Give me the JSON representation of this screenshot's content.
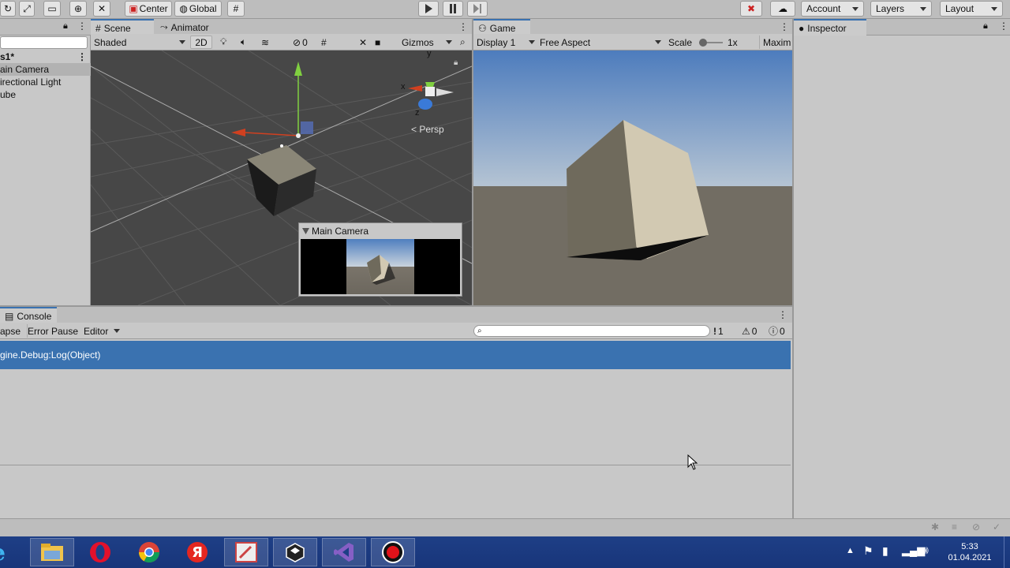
{
  "toolbar": {
    "center_label": "Center",
    "global_label": "Global",
    "account_label": "Account",
    "layers_label": "Layers",
    "layout_label": "Layout"
  },
  "hierarchy": {
    "scene_name": "s1*",
    "items": [
      "ain Camera",
      "irectional Light",
      "ube"
    ]
  },
  "scene_view": {
    "tabs": [
      "Scene",
      "Animator"
    ],
    "shading_mode": "Shaded",
    "mode_2d": "2D",
    "hidden_count": "0",
    "gizmos_label": "Gizmos",
    "axis_labels": {
      "x": "x",
      "y": "y",
      "z": "z"
    },
    "projection_label": "Persp",
    "camera_preview_title": "Main Camera"
  },
  "game_view": {
    "tab": "Game",
    "display": "Display 1",
    "aspect": "Free Aspect",
    "scale_label": "Scale",
    "scale_value": "1x",
    "maximize_label": "Maxim"
  },
  "inspector": {
    "tab": "Inspector"
  },
  "console": {
    "tab": "Console",
    "collapse_label": "apse",
    "error_pause_label": "Error Pause",
    "editor_label": "Editor",
    "log_count": "1",
    "warn_count": "0",
    "error_count": "0",
    "entries": [
      "gine.Debug:Log(Object)"
    ]
  },
  "taskbar": {
    "time": "5:33",
    "date": "01.04.2021"
  },
  "colors": {
    "selection_blue": "#3a72b0",
    "sky_top": "#4f7fbf",
    "ground": "#726d63",
    "cube_light": "#d2c9b2",
    "taskbar": "#1e3f86"
  }
}
